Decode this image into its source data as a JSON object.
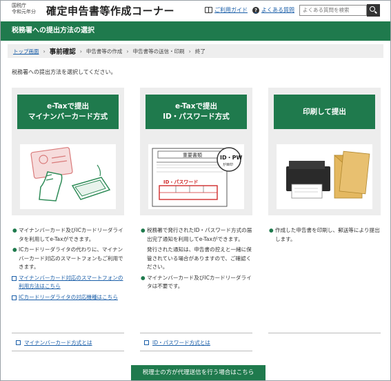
{
  "header": {
    "agency_line1": "国税庁",
    "agency_line2": "令和元年分",
    "title": "確定申告書等作成コーナー",
    "guide_link": "ご利用ガイド",
    "faq_link": "よくある質問",
    "search_placeholder": "よくある質問を検索"
  },
  "section_title": "税務署への提出方法の選択",
  "breadcrumb": {
    "items": [
      "トップ画面",
      "事前確認",
      "申告書等の作成",
      "申告書等の送信・印刷",
      "終了"
    ]
  },
  "instruction": "税務署への提出方法を選択してください。",
  "cards": [
    {
      "line1": "e-Taxで提出",
      "line2": "マイナンバーカード方式",
      "bullets": [
        "マイナンバーカード及びICカードリーダライタを利用してe-Taxができます。",
        "ICカードリーダライタの代わりに、マイナンバーカード対応のスマートフォンもご利用できます。"
      ],
      "links": [
        "マイナンバーカード対応のスマートフォンの利用方法はこちら",
        "ICカードリーダライタの対応機種はこちら"
      ],
      "about": "マイナンバーカード方式とは"
    },
    {
      "line1": "e-Taxで提出",
      "line2": "ID・パスワード方式",
      "bullets": [
        "税務署で発行されたID・パスワード方式の届出完了通知を利用してe-Taxができます。"
      ],
      "extra": "発行された通知は、申告書の控えと一緒に保管されている場合がありますので、ご確認ください。",
      "bullets2": [
        "マイナンバーカード及びICカードリーダライタは不要です。"
      ],
      "about": "ID・パスワード方式とは",
      "img_label": "ID・パスワード",
      "img_badge": "ID・PW",
      "img_badge_sub": "が目印",
      "img_doc_title": "重要書類"
    },
    {
      "line1": "印刷して提出",
      "bullets": [
        "作成した申告書を印刷し、郵送等により提出します。"
      ]
    }
  ],
  "bottom_button": "税理士の方が代理送信を行う場合はこちら",
  "colors": {
    "brand": "#1f7a4d",
    "link": "#1a5ea8"
  }
}
